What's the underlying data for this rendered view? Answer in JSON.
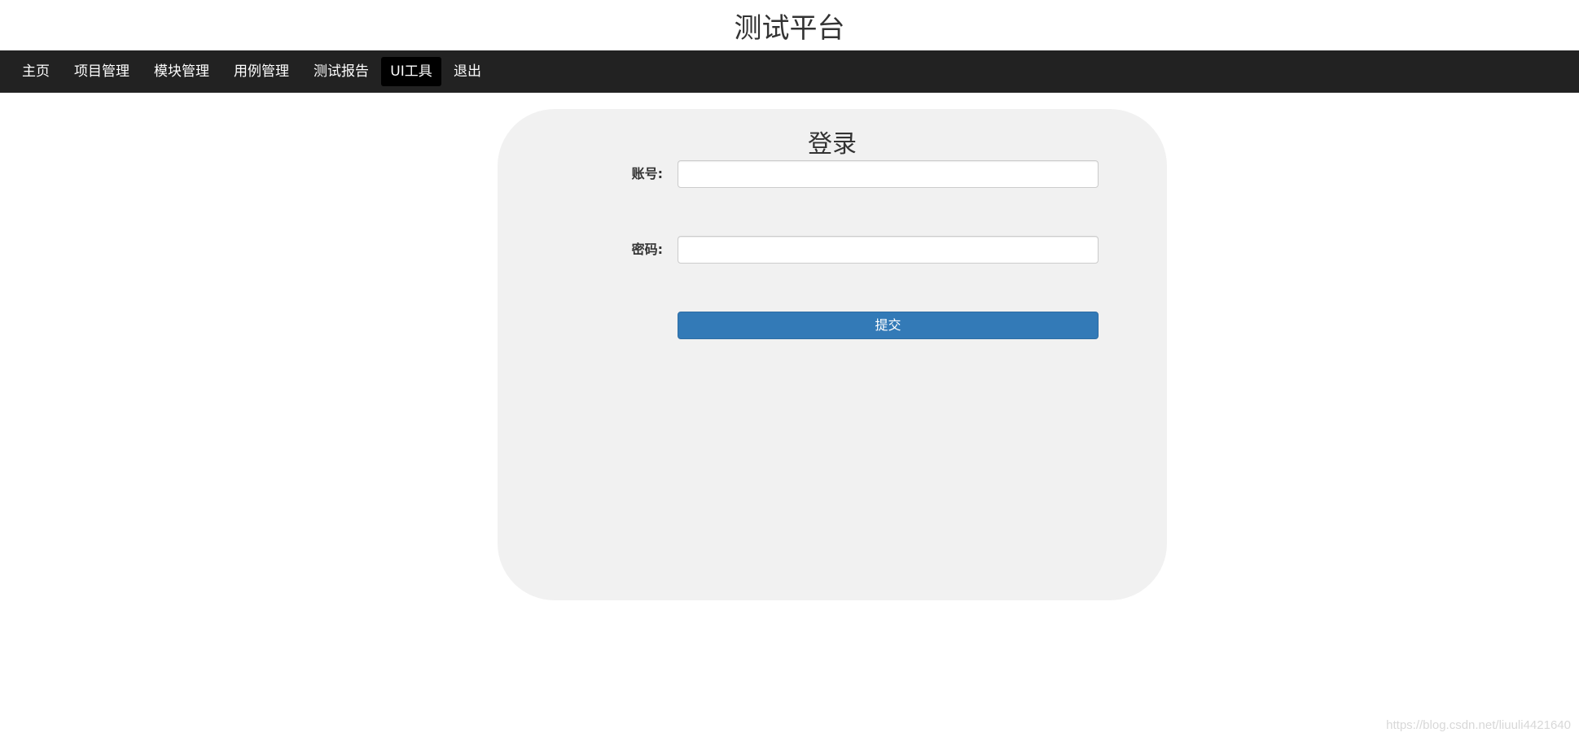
{
  "header": {
    "title": "测试平台"
  },
  "nav": {
    "items": [
      {
        "label": "主页"
      },
      {
        "label": "项目管理"
      },
      {
        "label": "模块管理"
      },
      {
        "label": "用例管理"
      },
      {
        "label": "测试报告"
      },
      {
        "label": "UI工具",
        "active": true
      },
      {
        "label": "退出"
      }
    ]
  },
  "login": {
    "title": "登录",
    "account_label": "账号:",
    "account_value": "",
    "password_label": "密码:",
    "password_value": "",
    "submit_label": "提交"
  },
  "watermark": "https://blog.csdn.net/liuuli4421640",
  "colors": {
    "navbar_bg": "#222222",
    "nav_active_bg": "#000000",
    "panel_bg": "#f1f1f1",
    "button_primary": "#337ab7"
  }
}
